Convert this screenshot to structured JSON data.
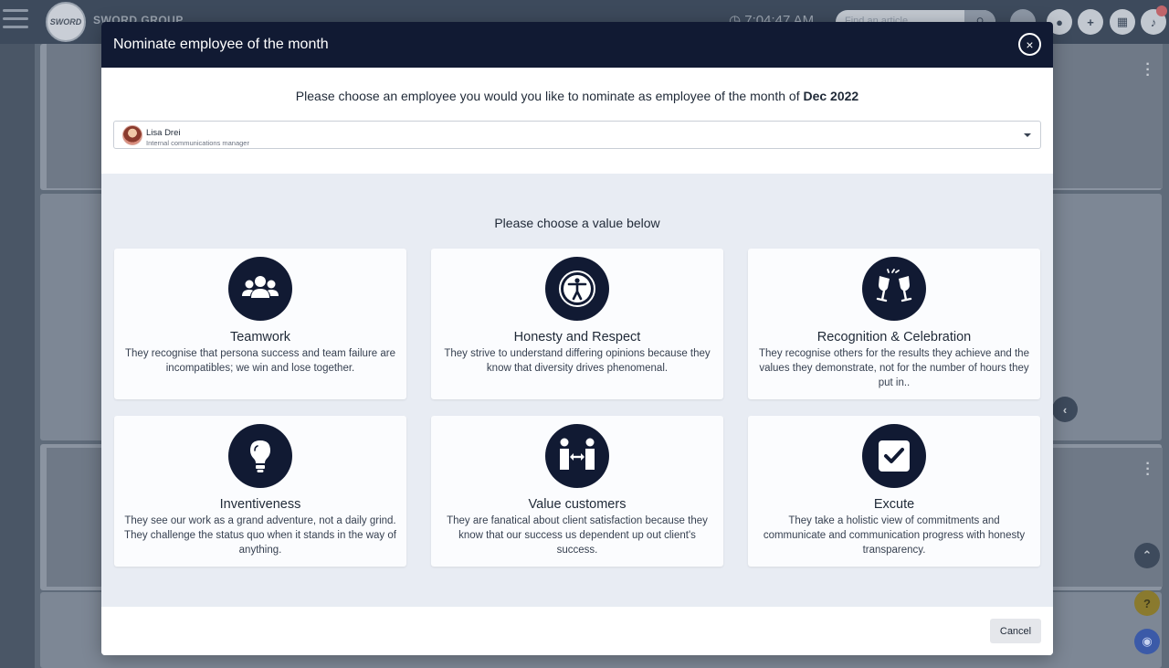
{
  "background": {
    "company_name": "SWORD GROUP",
    "logo_text": "SWORD",
    "clock": "7:04:47 AM",
    "search_placeholder": "Find an article"
  },
  "modal": {
    "title": "Nominate employee of the month",
    "prompt_text": "Please choose an employee you would you like to nominate as employee of the month of ",
    "prompt_month": "Dec 2022",
    "selected_employee": {
      "name": "Lisa Drei",
      "role": "Internal communications manager"
    },
    "values_heading": "Please choose a value below",
    "values": [
      {
        "title": "Teamwork",
        "icon": "users-icon",
        "description": "They recognise that persona success and team failure are incompatibles; we win and lose together."
      },
      {
        "title": "Honesty and Respect",
        "icon": "universal-access-icon",
        "description": "They strive to understand differing opinions because they know that diversity drives phenomenal."
      },
      {
        "title": "Recognition & Celebration",
        "icon": "glasses-cheers-icon",
        "description": "They recognise others for the results they achieve and the values they demonstrate, not for the number of hours they put in.."
      },
      {
        "title": "Inventiveness",
        "icon": "lightbulb-icon",
        "description": "They see our work as a grand adventure, not a daily grind. They challenge the status quo when it stands in the way of anything."
      },
      {
        "title": "Value customers",
        "icon": "people-arrows-icon",
        "description": "They are fanatical about client satisfaction because they know that our success us dependent up out client's success."
      },
      {
        "title": "Excute",
        "icon": "check-square-icon",
        "description": "They take a holistic view of commitments and communicate and communication progress with honesty transparency."
      }
    ],
    "cancel_label": "Cancel",
    "close_symbol": "×"
  },
  "colors": {
    "header_bg": "#111a33",
    "icon_bg": "#111a33",
    "values_bg": "#e8ecf3"
  }
}
